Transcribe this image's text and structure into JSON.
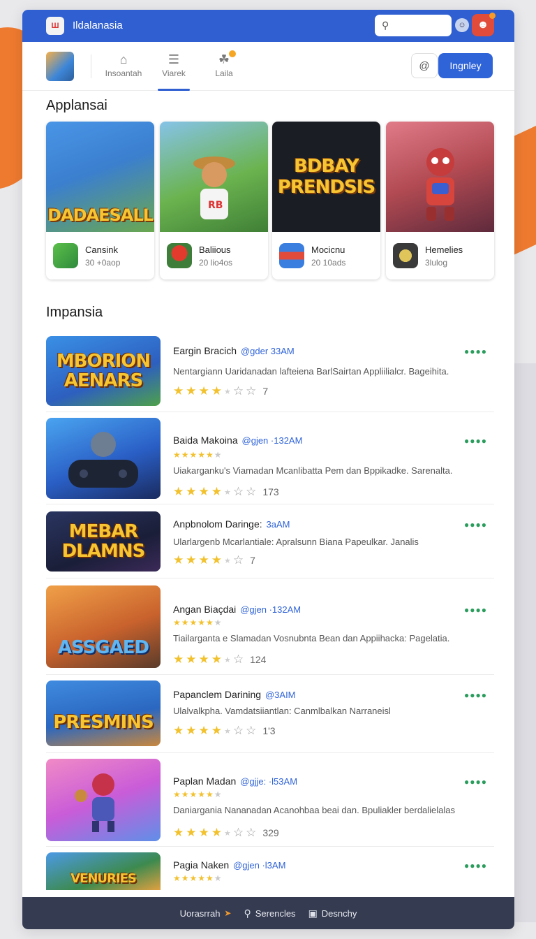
{
  "window": {
    "title": "Ildalanasia"
  },
  "search": {
    "placeholder": ""
  },
  "nav": {
    "tabs": [
      {
        "label": "Insoantah",
        "icon": "home-icon"
      },
      {
        "label": "Viarek",
        "icon": "list-icon"
      },
      {
        "label": "Laila",
        "icon": "bell-icon"
      }
    ],
    "login_label": "Ingnley"
  },
  "featured": {
    "heading": "Applansai",
    "items": [
      {
        "art_text": "DADAESALL",
        "name": "Cansink",
        "sub": "30 +0aop",
        "color": "#3e88d6"
      },
      {
        "art_text": "",
        "name": "Baliious",
        "sub": "20 lio4os",
        "color": "#5fa944"
      },
      {
        "art_text": "BDBAY PRENDSIS",
        "name": "Mocicnu",
        "sub": "20 10ads",
        "color": "#1b1d24"
      },
      {
        "art_text": "",
        "name": "Hemelies",
        "sub": "3lulog",
        "color": "#a64650"
      }
    ]
  },
  "list": {
    "heading": "Impansia",
    "items": [
      {
        "art_text": "MBORION AENARS",
        "title": "Eargin Bracich",
        "tag": "@gder  33AM",
        "desc": "Nentargiann Uaridanadan lafteiena BarlSairtan Appliilialcr. Bageihita.",
        "count": "7",
        "mini": false,
        "color": "#2f7ed6"
      },
      {
        "art_text": "",
        "title": "Baida Makoina",
        "tag": "@gjen  ·132AM",
        "desc": "Uiakarganku's Viamadan Mcanlibatta Pem dan Bppikadke. Sarenalta.",
        "count": "173",
        "mini": true,
        "color": "#2d6fd2"
      },
      {
        "art_text": "MEBAR DLAMNS",
        "title": "Anpbnolom Daringe:",
        "tag": "3aAM",
        "desc": "Ularlargenb Mcarlantiale: Apralsunn Biana Papeulkar. Janalis",
        "count": "7",
        "mini": false,
        "color": "#1f2747"
      },
      {
        "art_text": "ASSGAED",
        "title": "Angan Biaçdai",
        "tag": "@gjen  ·132AM",
        "desc": "Tiailarganta e Slamadan Vosnubnta Bean dan Appiihacka: Pagelatia.",
        "count": "124",
        "mini": true,
        "color": "#d8782e"
      },
      {
        "art_text": "PRESMINS",
        "title": "Papanclem Darining",
        "tag": "@3AIM",
        "desc": "Ulalvalkpha. Vamdatsiiantlan: Canmlbalkan Narraneisl",
        "count": "1'3",
        "mini": false,
        "color": "#3b7fd4"
      },
      {
        "art_text": "",
        "title": "Paplan Madan",
        "tag": "@gjje:  ·l53AM",
        "desc": "Daniargania Nananadan Acanohbaa beai dan.  Bpuliakler berdalielalas",
        "count": "329",
        "mini": true,
        "color": "#de5fa4"
      },
      {
        "art_text": "VENURIES",
        "title": "Pagia Naken",
        "tag": "@gjen  ·l3AM",
        "desc": "",
        "count": "",
        "mini": true,
        "color": "#3d8a4f"
      }
    ]
  },
  "bottombar": {
    "items": [
      {
        "label": "Uorasrrah",
        "icon": "arrow-icon"
      },
      {
        "label": "Serencles",
        "icon": "search-icon"
      },
      {
        "label": "Desnchy",
        "icon": "grid-icon"
      }
    ]
  }
}
